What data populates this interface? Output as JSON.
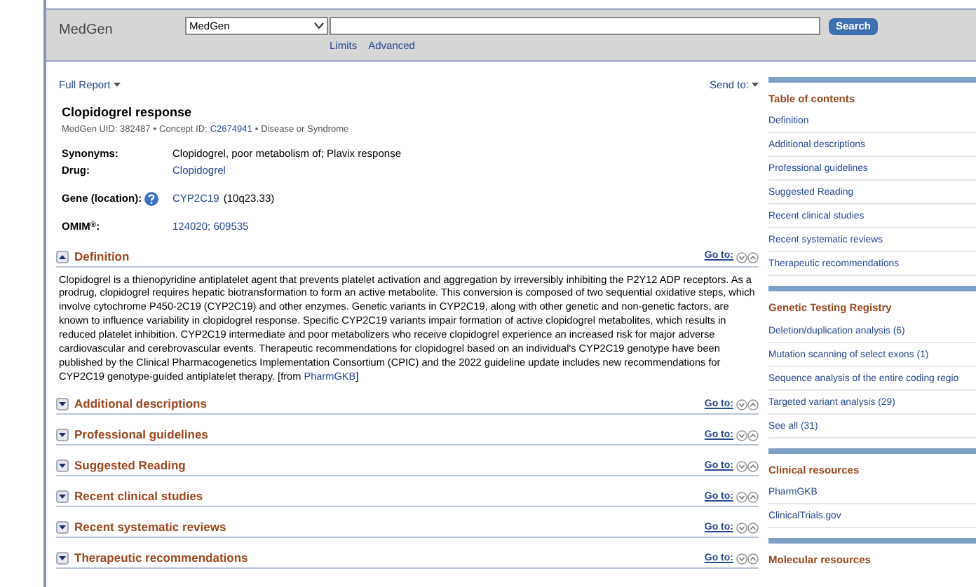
{
  "header": {
    "logo": "MedGen",
    "database_select": "MedGen",
    "search_button": "Search",
    "links": [
      "Limits",
      "Advanced"
    ]
  },
  "toolbar": {
    "report_menu": "Full Report",
    "send_menu": "Send to:"
  },
  "record": {
    "title": "Clopidogrel response",
    "meta": [
      {
        "kind": "text",
        "text": "MedGen UID: 382487"
      },
      {
        "kind": "separator",
        "text": "•"
      },
      {
        "kind": "text",
        "text": "Concept ID:"
      },
      {
        "kind": "link",
        "text": "C2674941"
      },
      {
        "kind": "separator",
        "text": "•"
      },
      {
        "kind": "text",
        "text": "Disease or Syndrome"
      }
    ],
    "fields": [
      {
        "label": "Synonyms:",
        "values": [
          {
            "text": "Clopidogrel, poor metabolism of; Plavix response",
            "kind": "text"
          }
        ]
      },
      {
        "label": "Drug:",
        "values": [
          {
            "text": "Clopidogrel",
            "kind": "link"
          }
        ]
      },
      {
        "label": "Gene (location):",
        "help": true,
        "values": [
          {
            "text": "CYP2C19",
            "kind": "link"
          },
          {
            "text": "(10q23.33)",
            "kind": "text"
          }
        ]
      },
      {
        "label": "OMIM$^{®}$:",
        "values": [
          {
            "text": "124020; 609535",
            "kind": "link"
          }
        ]
      }
    ]
  },
  "sections": [
    {
      "title": "Definition",
      "expanded": true,
      "goto": "Go to:",
      "text_before": "Clopidogrel is a thienopyridine antiplatelet agent that prevents platelet activation and aggregation by irreversibly inhibiting the P2Y12 ADP receptors. As a prodrug, clopidogrel requires hepatic biotransformation to form an active metabolite. This conversion is composed of two sequential oxidative steps, which involve cytochrome P450-2C19 (CYP2C19) and other enzymes. Genetic variants in CYP2C19, along with other genetic and non-genetic factors, are known to influence variability in clopidogrel response. Specific CYP2C19 variants impair formation of active clopidogrel metabolites, which results in reduced platelet inhibition. CYP2C19 intermediate and poor metabolizers who receive clopidogrel experience an increased risk for major adverse cardiovascular and cerebrovascular events. Therapeutic recommendations for clopidogrel based on an individual's CYP2C19 genotype have been published by the Clinical Pharmacogenetics Implementation Consortium (CPIC) and the 2022 guideline update includes new recommendations for CYP2C19 genotype-guided antiplatelet therapy. [from ",
      "source_link": "PharmGKB",
      "text_after": "]"
    },
    {
      "title": "Additional descriptions",
      "expanded": false,
      "goto": "Go to:"
    },
    {
      "title": "Professional guidelines",
      "expanded": false,
      "goto": "Go to:"
    },
    {
      "title": "Suggested Reading",
      "expanded": false,
      "goto": "Go to:"
    },
    {
      "title": "Recent clinical studies",
      "expanded": false,
      "goto": "Go to:"
    },
    {
      "title": "Recent systematic reviews",
      "expanded": false,
      "goto": "Go to:"
    },
    {
      "title": "Therapeutic recommendations",
      "expanded": false,
      "goto": "Go to:"
    }
  ],
  "sidebar": [
    {
      "title": "Table of contents",
      "items": [
        "Definition",
        "Additional descriptions",
        "Professional guidelines",
        "Suggested Reading",
        "Recent clinical studies",
        "Recent systematic reviews",
        "Therapeutic recommendations"
      ]
    },
    {
      "title": "Genetic Testing Registry",
      "items": [
        "Deletion/duplication analysis (6)",
        "Mutation scanning of select exons (1)",
        "Sequence analysis of the entire coding regio",
        "Targeted variant analysis (29)",
        "See all (31)"
      ]
    },
    {
      "title": "Clinical resources",
      "items": [
        "PharmGKB",
        "ClinicalTrials.gov"
      ]
    },
    {
      "title": "Molecular resources"
    }
  ]
}
